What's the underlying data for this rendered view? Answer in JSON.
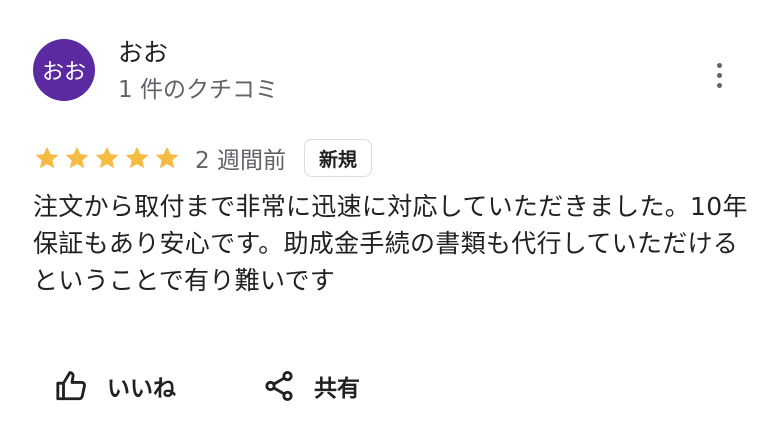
{
  "author": {
    "avatar_text": "おお",
    "name": "おお",
    "review_count": "1 件のクチコミ"
  },
  "review": {
    "rating": 5,
    "rating_max": 5,
    "time_ago": "2 週間前",
    "badge": "新規",
    "text": "注文から取付まで非常に迅速に対応していただきました。10年保証もあり安心です。助成金手続の書類も代行していただけるということで有り難いです"
  },
  "actions": {
    "like_label": "いいね",
    "share_label": "共有"
  },
  "icons": {
    "more": "more-vert-icon",
    "star": "star-icon",
    "like": "thumb-up-icon",
    "share": "share-icon"
  },
  "colors": {
    "avatar_bg": "#5b2aa0",
    "star": "#f6bb42",
    "secondary_text": "#5f6368",
    "primary_text": "#202124"
  }
}
